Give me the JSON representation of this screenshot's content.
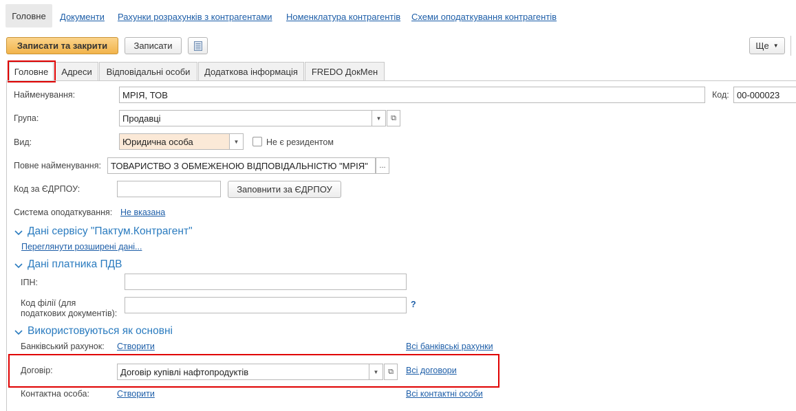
{
  "nav": {
    "active": "Головне",
    "links": [
      "Документи",
      "Рахунки розрахунків з контрагентами",
      "Номенклатура контрагентів",
      "Схеми оподаткування контрагентів"
    ]
  },
  "toolbar": {
    "save_close": "Записати та закрити",
    "save": "Записати",
    "more": "Ще"
  },
  "tabs": [
    "Головне",
    "Адреси",
    "Відповідальні особи",
    "Додаткова інформація",
    "FREDO ДокМен"
  ],
  "form": {
    "name_label": "Найменування:",
    "name_value": "МРІЯ, ТОВ",
    "code_label": "Код:",
    "code_value": "00-000023",
    "group_label": "Група:",
    "group_value": "Продавці",
    "kind_label": "Вид:",
    "kind_value": "Юридична особа",
    "nonresident_label": "Не є резидентом",
    "full_name_label": "Повне найменування:",
    "full_name_value": "ТОВАРИСТВО З ОБМЕЖЕНОЮ ВІДПОВІДАЛЬНІСТЮ \"МРІЯ\"",
    "edrpou_label": "Код за ЄДРПОУ:",
    "edrpou_value": "",
    "fill_edrpou": "Заповнити за ЄДРПОУ",
    "tax_system_label": "Система оподаткування:",
    "tax_system_value": "Не вказана"
  },
  "pactum": {
    "title": "Дані сервісу \"Пактум.Контрагент\"",
    "link": "Переглянути розширені дані..."
  },
  "vat": {
    "title": "Дані платника ПДВ",
    "ipn_label": "ІПН:",
    "ipn_value": "",
    "branch_label_1": "Код філії (для",
    "branch_label_2": "податкових документів):",
    "branch_value": "",
    "help": "?"
  },
  "defaults": {
    "title": "Використовуються як основні",
    "bank_label": "Банківський рахунок:",
    "bank_create": "Створити",
    "bank_all": "Всі банківські рахунки",
    "contract_label": "Договір:",
    "contract_value": "Договір купівлі нафтопродуктів",
    "contract_all": "Всі договори",
    "contact_label": "Контактна особа:",
    "contact_create": "Створити",
    "contact_all": "Всі контактні особи"
  },
  "colors": {
    "highlight": "#e00000",
    "section": "#2a7bbf",
    "link": "#1d5ea8",
    "primary_button": "#f2b44b"
  }
}
